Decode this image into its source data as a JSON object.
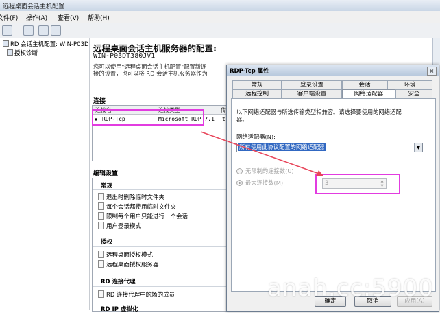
{
  "window": {
    "title": "远程桌面会话主机配置"
  },
  "menu": [
    "文件(F)",
    "操作(A)",
    "查看(V)",
    "帮助(H)"
  ],
  "tree": {
    "root": "RD 会话主机配置: WIN-P03D",
    "child": "授权诊断"
  },
  "main": {
    "title": "远程桌面会话主机服务器的配置:",
    "server": "WIN-P03DT380JV1",
    "desc_line1": "您可以使用\"远程桌面会话主机配置\"配置新连",
    "desc_line2": "接的设置，也可以将 RD 会话主机服务器作为",
    "connections_header": "连接",
    "table_headers": [
      "连接名",
      "连接类型",
      "传"
    ],
    "table_row": {
      "name": "RDP-Tcp",
      "type": "Microsoft RDP 7.1",
      "extra": "t"
    },
    "edit_header": "编辑设置",
    "sections": [
      {
        "title": "常规",
        "items": [
          "退出时删除临时文件夹",
          "每个会话都使用临时文件夹",
          "限制每个用户只能进行一个会话",
          "用户登录模式"
        ]
      },
      {
        "title": "授权",
        "items": [
          "远程桌面授权模式",
          "远程桌面授权服务器"
        ]
      },
      {
        "title": "RD 连接代理",
        "items": [
          "RD 连接代理中的场的成员"
        ]
      },
      {
        "title": "RD IP 虚拟化",
        "items": []
      }
    ]
  },
  "dialog": {
    "title": "RDP-Tcp 属性",
    "close": "×",
    "tabs_row1": [
      "常规",
      "登录设置",
      "会话",
      "环境"
    ],
    "tabs_row2": [
      "远程控制",
      "客户端设置",
      "网络适配器",
      "安全"
    ],
    "active_tab": "网络适配器",
    "intro_line1": "以下网络适配器与所选传输类型相兼容。请选择要使用的网络适配",
    "intro_line2": "器。",
    "adapter_label": "网络适配器(N):",
    "adapter_value": "所有使用此协议配置的网络适配器",
    "radio_unlimited": "无限制的连接数(U)",
    "radio_max": "最大连接数(M)",
    "max_value": "3",
    "buttons": {
      "ok": "确定",
      "cancel": "取消",
      "apply": "应用(A)"
    }
  },
  "watermark": "anah.cc:5900",
  "colors": {
    "highlight": "#e23ce0",
    "arrow": "#e8455a",
    "selection": "#3168c2"
  }
}
